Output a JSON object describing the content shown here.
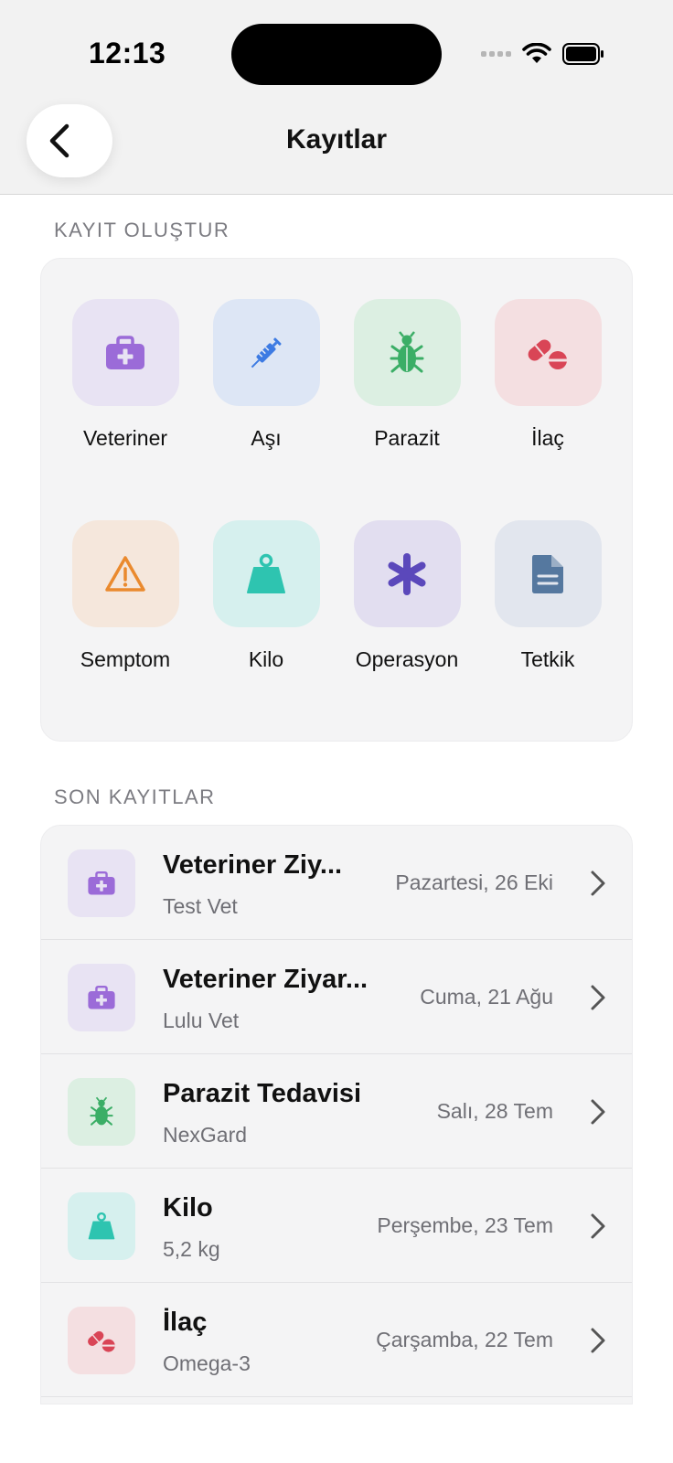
{
  "status_bar": {
    "time": "12:13"
  },
  "header": {
    "title": "Kayıtlar",
    "back_icon": "chevron-left-icon"
  },
  "create_section": {
    "label": "KAYIT OLUŞTUR",
    "items": [
      {
        "label": "Veteriner",
        "icon": "medical-bag-icon",
        "color": "#9B6BD8"
      },
      {
        "label": "Aşı",
        "icon": "syringe-icon",
        "color": "#3D7BE3"
      },
      {
        "label": "Parazit",
        "icon": "bug-icon",
        "color": "#3BAE66"
      },
      {
        "label": "İlaç",
        "icon": "pills-icon",
        "color": "#D94556"
      },
      {
        "label": "Semptom",
        "icon": "warning-icon",
        "color": "#EA8A2E"
      },
      {
        "label": "Kilo",
        "icon": "weight-icon",
        "color": "#2EC4B0"
      },
      {
        "label": "Operasyon",
        "icon": "asterisk-icon",
        "color": "#5B48BB"
      },
      {
        "label": "Tetkik",
        "icon": "document-icon",
        "color": "#55789F"
      }
    ]
  },
  "recent_section": {
    "label": "SON KAYITLAR",
    "items": [
      {
        "title": "Veteriner Ziy...",
        "subtitle": "Test Vet",
        "date": "Pazartesi, 26 Eki",
        "icon": "medical-bag-icon"
      },
      {
        "title": "Veteriner Ziyar...",
        "subtitle": "Lulu Vet",
        "date": "Cuma, 21 Ağu",
        "icon": "medical-bag-icon"
      },
      {
        "title": "Parazit Tedavisi",
        "subtitle": "NexGard",
        "date": "Salı, 28 Tem",
        "icon": "bug-icon"
      },
      {
        "title": "Kilo",
        "subtitle": "5,2 kg",
        "date": "Perşembe, 23 Tem",
        "icon": "weight-icon"
      },
      {
        "title": "İlaç",
        "subtitle": "Omega-3",
        "date": "Çarşamba, 22 Tem",
        "icon": "pills-icon"
      }
    ]
  }
}
